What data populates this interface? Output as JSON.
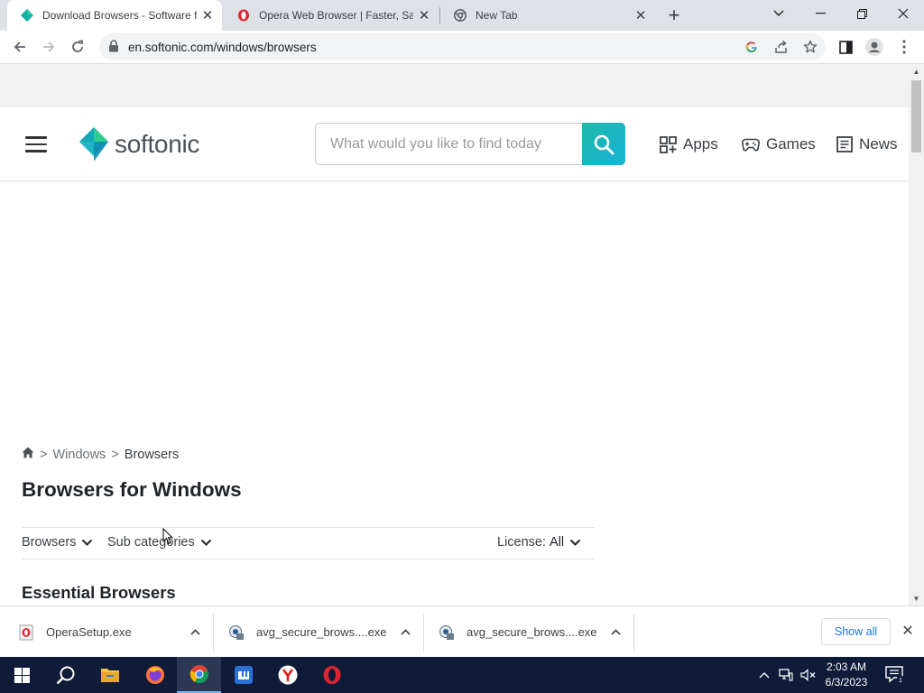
{
  "browser": {
    "tabs": [
      {
        "title": "Download Browsers - Software fo",
        "favicon": "softonic-favicon",
        "active": true
      },
      {
        "title": "Opera Web Browser | Faster, Safe",
        "favicon": "opera-favicon",
        "active": false
      },
      {
        "title": "New Tab",
        "favicon": "chrome-favicon",
        "active": false
      }
    ],
    "url": "en.softonic.com/windows/browsers"
  },
  "site": {
    "logo_text": "softonic",
    "search_placeholder": "What would you like to find today",
    "nav": [
      {
        "label": "Apps",
        "icon": "apps-grid-icon"
      },
      {
        "label": "Games",
        "icon": "gamepad-icon"
      },
      {
        "label": "News",
        "icon": "news-icon"
      }
    ],
    "accent_gradient": [
      "#1fb9a8",
      "#16b3d8"
    ]
  },
  "page": {
    "breadcrumb": {
      "level1": "Windows",
      "level2": "Browsers",
      "separator": ">"
    },
    "title": "Browsers for Windows",
    "filters": {
      "category": "Browsers",
      "subcategories": "Sub categories",
      "license_label": "License:",
      "license_value": "All"
    },
    "section_title": "Essential Browsers"
  },
  "downloads": {
    "items": [
      {
        "name": "OperaSetup.exe",
        "icon": "opera-installer-icon"
      },
      {
        "name": "avg_secure_brows....exe",
        "icon": "avg-installer-icon"
      },
      {
        "name": "avg_secure_brows....exe",
        "icon": "avg-installer-icon"
      }
    ],
    "show_all": "Show all"
  },
  "taskbar": {
    "apps": [
      "start-icon",
      "search-icon",
      "file-explorer-icon",
      "firefox-icon",
      "chrome-icon",
      "maxthon-icon",
      "yandex-icon",
      "opera-icon"
    ],
    "time": "2:03 AM",
    "date": "6/3/2023"
  }
}
